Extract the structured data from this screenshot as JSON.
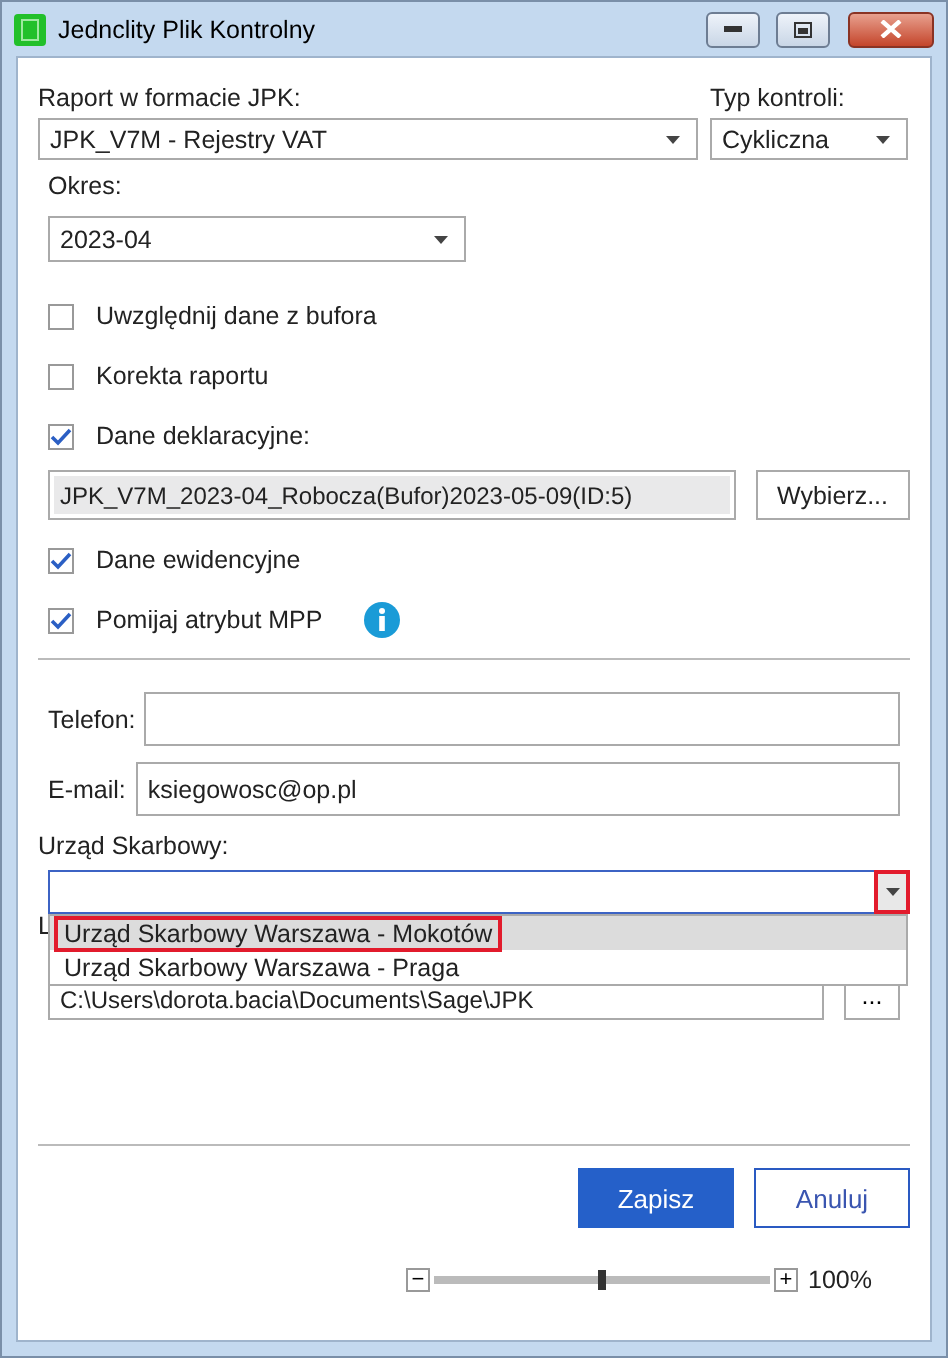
{
  "window": {
    "title": "Jednclity Plik Kontrolny"
  },
  "report": {
    "label": "Raport w formacie JPK:",
    "value": "JPK_V7M - Rejestry VAT"
  },
  "control_type": {
    "label": "Typ kontroli:",
    "value": "Cykliczna"
  },
  "period": {
    "label": "Okres:",
    "value": "2023-04"
  },
  "options": [
    {
      "kind": "checkbox",
      "label": "Uwzględnij dane z bufora",
      "checked": false
    },
    {
      "kind": "checkbox",
      "label": "Korekta raportu",
      "checked": false
    },
    {
      "kind": "checkbox",
      "label": "Dane deklaracyjne:",
      "checked": true
    },
    {
      "kind": "file",
      "value": "JPK_V7M_2023-04_Robocza(Bufor)2023-05-09(ID:5)",
      "button": "Wybierz..."
    },
    {
      "kind": "checkbox",
      "label": "Dane ewidencyjne",
      "checked": true
    },
    {
      "kind": "checkbox",
      "label": "Pomijaj atrybut MPP",
      "checked": true,
      "info": true
    }
  ],
  "phone": {
    "label": "Telefon:"
  },
  "email": {
    "label": "E-mail:",
    "value": "ksiegowosc@op.pl"
  },
  "tax_office": {
    "label": "Urząd Skarbowy:",
    "expanded": true,
    "button_highlighted": true,
    "options": [
      {
        "label": "Urząd Skarbowy Warszawa - Mokotów",
        "selected": true,
        "highlighted": true
      },
      {
        "label": "Urząd Skarbowy Warszawa - Praga",
        "selected": false,
        "highlighted": false
      }
    ]
  },
  "path": {
    "label": "L",
    "value": "C:\\Users\\dorota.bacia\\Documents\\Sage\\JPK",
    "button": "..."
  },
  "buttons": [
    {
      "label": "Zapisz",
      "kind": "primary"
    },
    {
      "label": "Anuluj",
      "kind": "secondary"
    }
  ],
  "zoom": {
    "minus": "−",
    "plus": "+",
    "level": 0.5,
    "reading": "100%"
  }
}
